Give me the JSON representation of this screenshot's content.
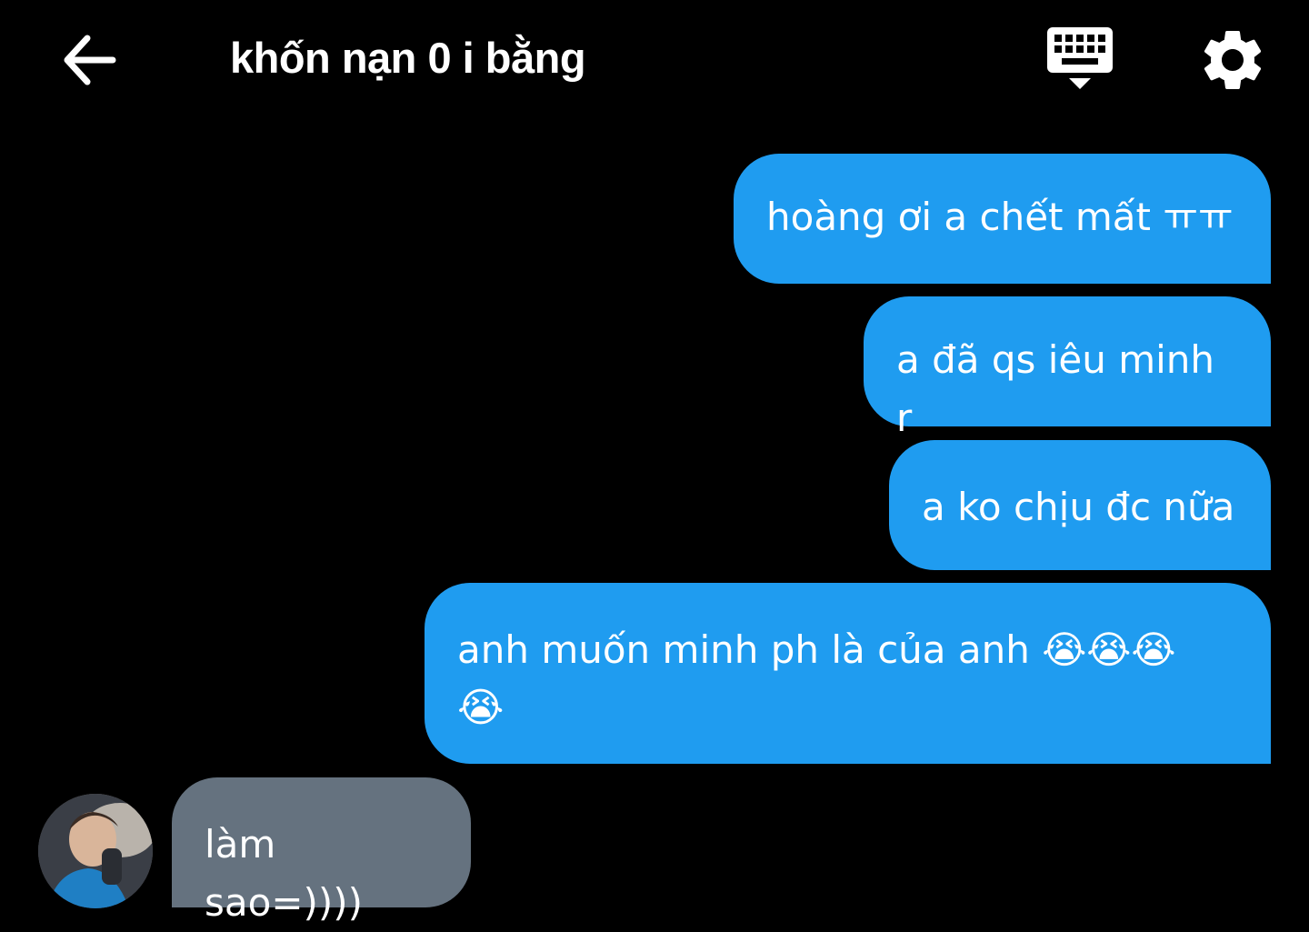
{
  "header": {
    "title": "khốn nạn 0 i bằng"
  },
  "messages": [
    {
      "direction": "outgoing",
      "text": "hoàng ơi a chết mất ㅠㅠ"
    },
    {
      "direction": "outgoing",
      "text": "a đã qs iêu minh r"
    },
    {
      "direction": "outgoing",
      "text": "a ko chịu đc nữa"
    },
    {
      "direction": "outgoing",
      "text": "anh muốn minh ph là của anh 😭😭😭",
      "text_line2": "😭"
    },
    {
      "direction": "incoming",
      "text": "làm sao=))))"
    }
  ],
  "colors": {
    "background": "#000000",
    "outgoing_bubble": "#1f9cf0",
    "incoming_bubble": "#65727f",
    "text": "#ffffff"
  },
  "icons": {
    "back": "arrow-left-icon",
    "keyboard": "keyboard-icon",
    "settings": "gear-icon"
  }
}
